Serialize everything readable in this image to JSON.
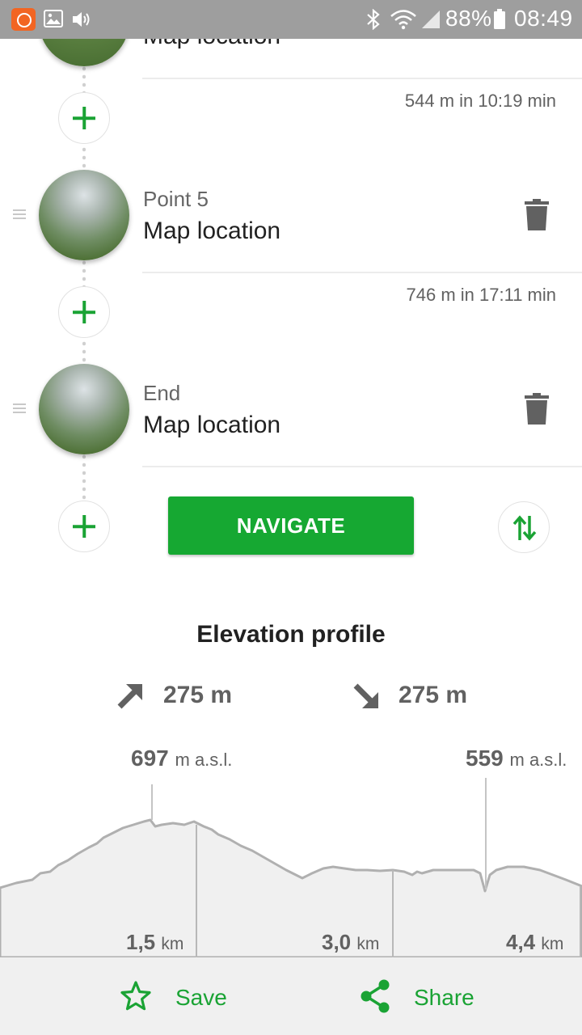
{
  "status_bar": {
    "battery": "88%",
    "time": "08:49",
    "icons": [
      "app-notification-icon",
      "gallery-icon",
      "volume-icon",
      "bluetooth-icon",
      "wifi-icon",
      "signal-icon",
      "battery-icon"
    ]
  },
  "waypoints": [
    {
      "label": "",
      "name": "Map location"
    },
    {
      "label": "Point 5",
      "name": "Map location"
    },
    {
      "label": "End",
      "name": "Map location"
    }
  ],
  "segments": [
    {
      "info": "544 m in 10:19 min"
    },
    {
      "info": "746 m in 17:11 min"
    }
  ],
  "navigate_label": "NAVIGATE",
  "elevation": {
    "title": "Elevation profile",
    "ascent": "275 m",
    "descent": "275 m",
    "peaks": [
      {
        "value": "697",
        "unit": "m a.s.l."
      },
      {
        "value": "559",
        "unit": "m a.s.l."
      }
    ],
    "distance_markers": [
      {
        "value": "1,5",
        "unit": "km"
      },
      {
        "value": "3,0",
        "unit": "km"
      },
      {
        "value": "4,4",
        "unit": "km"
      }
    ]
  },
  "actions": {
    "save": "Save",
    "share": "Share"
  },
  "colors": {
    "accent": "#16a832",
    "status_bar": "#9e9e9e",
    "profile_fill": "#f0f0f0",
    "profile_line": "#b0b0b0"
  }
}
